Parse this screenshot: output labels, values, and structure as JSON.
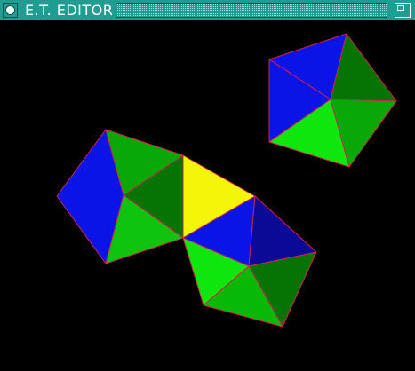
{
  "window": {
    "title": "E.T. EDITOR",
    "close_icon": "close-box-icon",
    "zoom_icon": "zoom-box-icon"
  },
  "colors": {
    "titlebar": "#1f9d93",
    "background": "#000000",
    "blue": "#0a14e6",
    "dark_blue": "#0a0a96",
    "green": "#07a807",
    "bright_green": "#0ee60e",
    "dark_green": "#057405",
    "yellow": "#f5f50a",
    "edge": "#d0244c"
  }
}
